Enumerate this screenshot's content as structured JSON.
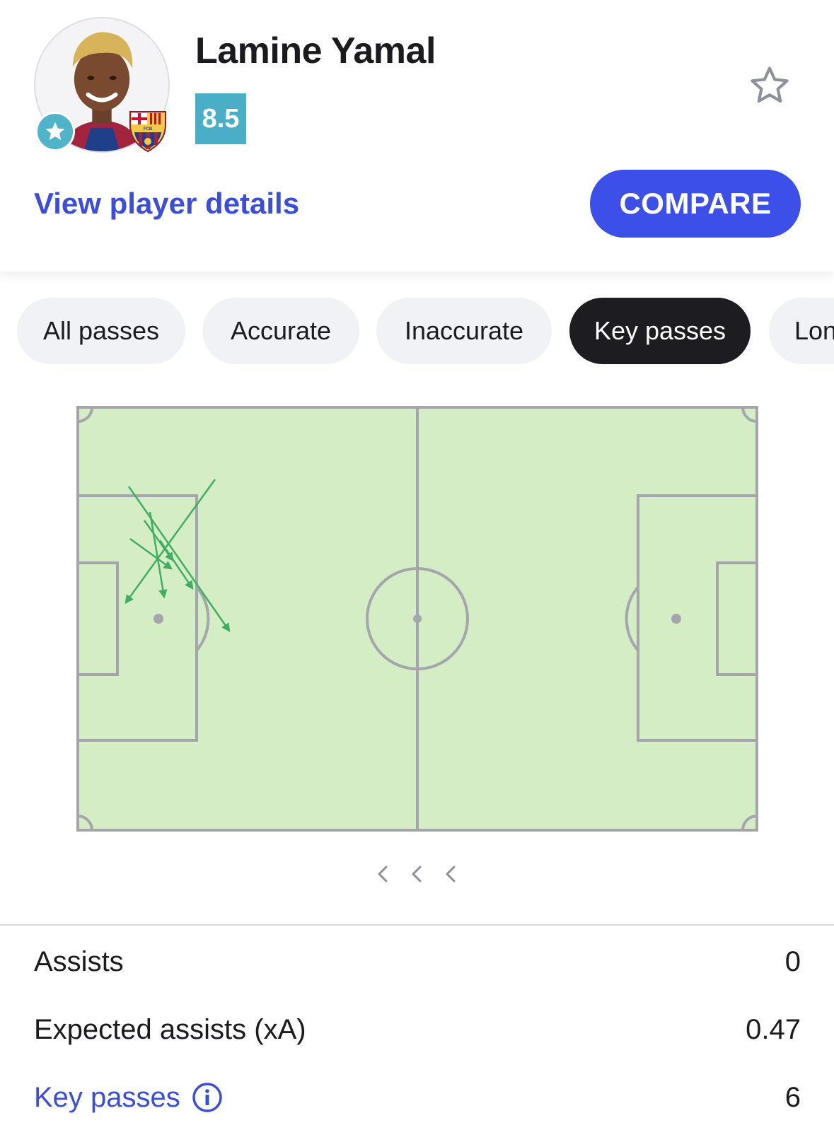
{
  "player": {
    "name": "Lamine Yamal",
    "rating": "8.5",
    "club_badge_text": "FCB",
    "details_link": "View player details",
    "compare_label": "COMPARE"
  },
  "colors": {
    "accent": "#3d4fe9",
    "link": "#3a4ed9",
    "rating_bg": "#4aaec6",
    "pitch": "#d4edc4",
    "pass_arrow": "#3fae62",
    "active_tab": "#1d1d21"
  },
  "icons": {
    "favorite_badge": "star-icon",
    "follow": "star-outline-icon",
    "pager": "chevron-left-icon",
    "info": "info-circle-icon"
  },
  "filters": [
    {
      "label": "All passes",
      "active": false
    },
    {
      "label": "Accurate",
      "active": false
    },
    {
      "label": "Inaccurate",
      "active": false
    },
    {
      "label": "Key passes",
      "active": true
    },
    {
      "label": "Lon",
      "active": false
    }
  ],
  "stats": [
    {
      "label": "Assists",
      "value": "0"
    },
    {
      "label": "Expected assists (xA)",
      "value": "0.47"
    },
    {
      "label": "Key passes",
      "value": "6"
    }
  ]
}
